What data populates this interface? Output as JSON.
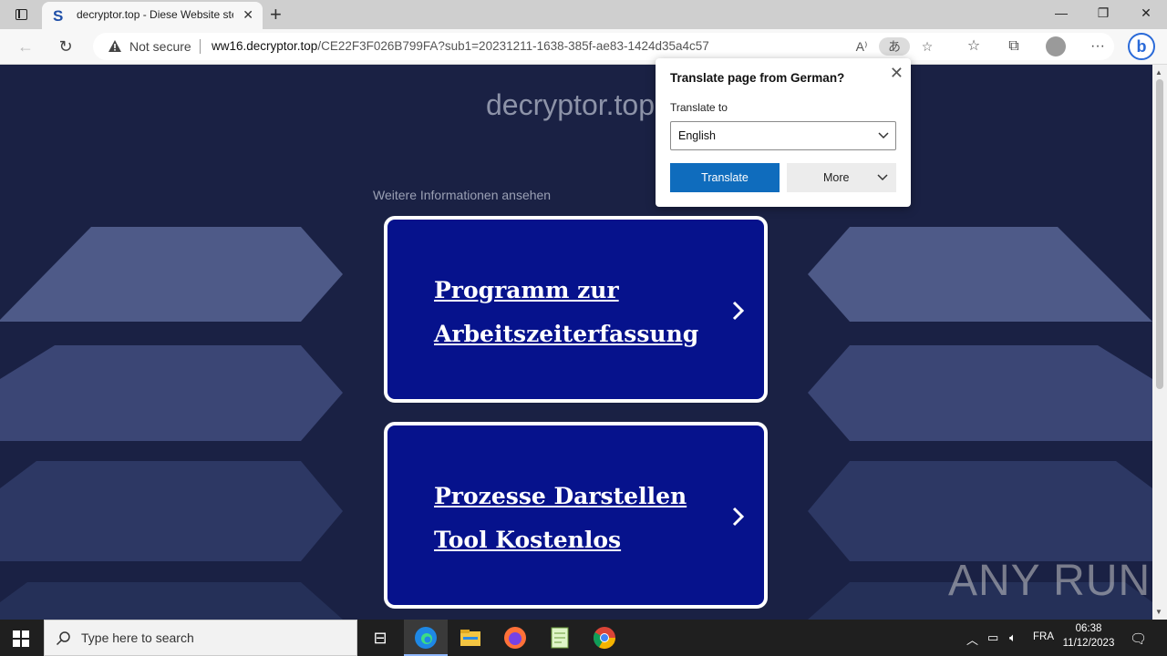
{
  "tab": {
    "title": "decryptor.top - Diese Website ste",
    "favicon_letter": "S"
  },
  "address": {
    "security_label": "Not secure",
    "url_host": "ww16.decryptor.top",
    "url_path": "/CE22F3F026B799FA?sub1=20231211-1638-385f-ae83-1424d35a4c57"
  },
  "page": {
    "site_title": "decryptor.top",
    "more_info": "Weitere Informationen ansehen",
    "cards": [
      {
        "line1": "Programm zur",
        "line2": "Arbeitszeiterfassung"
      },
      {
        "line1": "Prozesse Darstellen",
        "line2": "Tool Kostenlos"
      }
    ]
  },
  "translate_popup": {
    "title": "Translate page from German?",
    "translate_to_label": "Translate to",
    "selected_language": "English",
    "translate_button": "Translate",
    "more_button": "More"
  },
  "watermark": "ANY RUN",
  "taskbar": {
    "search_placeholder": "Type here to search",
    "language": "FRA",
    "time": "06:38",
    "date": "11/12/2023"
  },
  "colors": {
    "page_bg": "#1a2144",
    "card_bg": "#06128c",
    "translate_btn": "#0f6cbd",
    "hex_shape": "#4e5a88"
  }
}
